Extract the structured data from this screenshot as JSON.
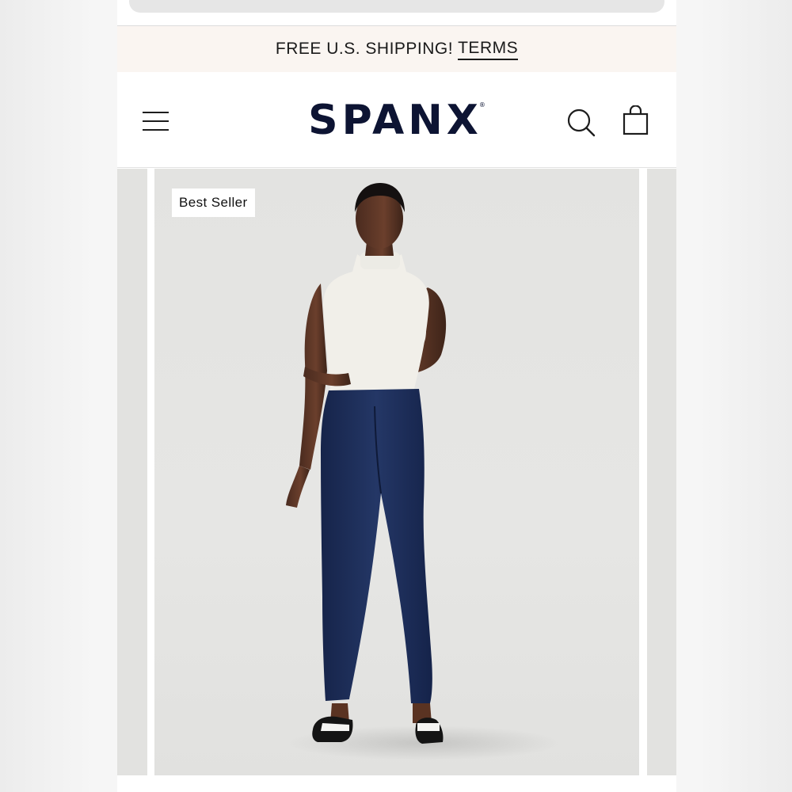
{
  "promo_bar": {
    "text": "FREE U.S. SHIPPING!",
    "link": "TERMS"
  },
  "header": {
    "logo": "SPANX",
    "logo_mark": "®",
    "icons": {
      "menu": "hamburger-menu-icon",
      "search": "search-icon",
      "bag": "shopping-bag-icon"
    }
  },
  "product": {
    "badge": "Best Seller"
  },
  "colors": {
    "promo_background": "#faf5f1",
    "logo": "#0d1433",
    "denim": "#1d2d57"
  }
}
